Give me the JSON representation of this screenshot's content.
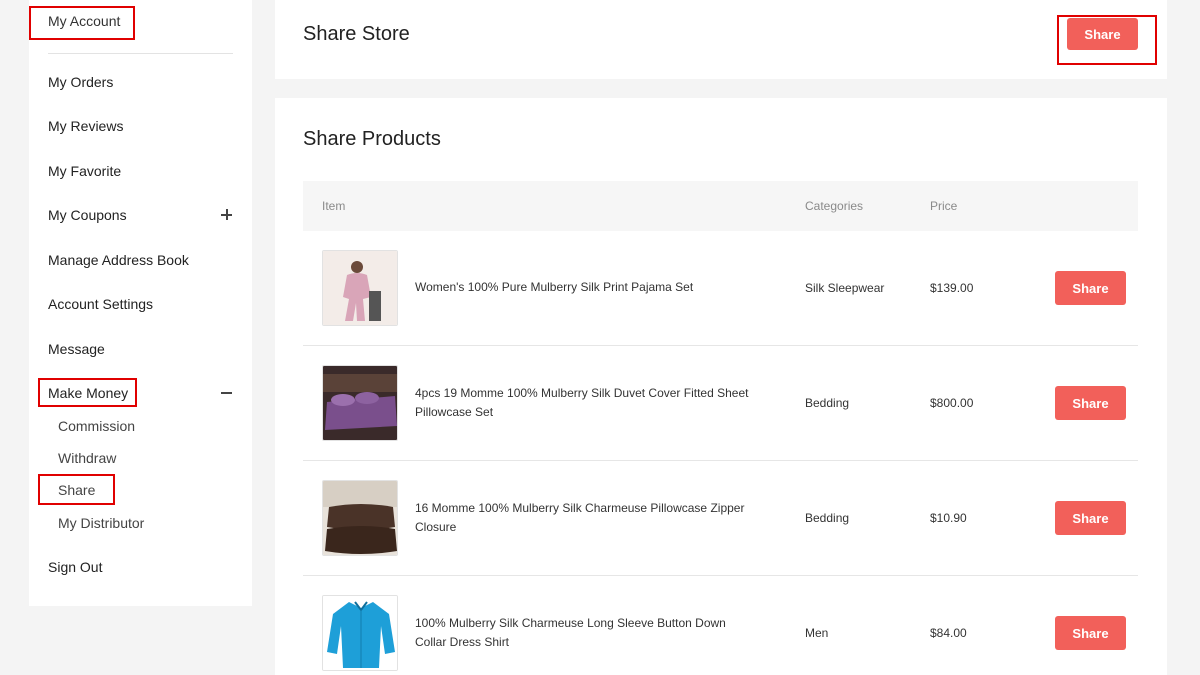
{
  "sidebar": {
    "account": "My Account",
    "items": [
      {
        "label": "My Orders"
      },
      {
        "label": "My Reviews"
      },
      {
        "label": "My Favorite"
      },
      {
        "label": "My Coupons",
        "toggle": "plus"
      },
      {
        "label": "Manage Address Book"
      },
      {
        "label": "Account Settings"
      },
      {
        "label": "Message"
      },
      {
        "label": "Make Money",
        "toggle": "minus"
      }
    ],
    "make_money_sub": [
      "Commission",
      "Withdraw",
      "Share",
      "My Distributor"
    ],
    "sign_out": "Sign Out"
  },
  "store": {
    "title": "Share Store",
    "share_label": "Share"
  },
  "products": {
    "title": "Share Products",
    "columns": [
      "Item",
      "Categories",
      "Price"
    ],
    "share_label": "Share",
    "rows": [
      {
        "name": "Women's 100% Pure Mulberry Silk Print Pajama Set",
        "category": "Silk Sleepwear",
        "price": "$139.00"
      },
      {
        "name": "4pcs 19 Momme 100% Mulberry Silk Duvet Cover Fitted Sheet Pillowcase Set",
        "category": "Bedding",
        "price": "$800.00"
      },
      {
        "name": "16 Momme 100% Mulberry Silk Charmeuse Pillowcase Zipper Closure",
        "category": "Bedding",
        "price": "$10.90"
      },
      {
        "name": "100% Mulberry Silk Charmeuse Long Sleeve Button Down Collar Dress Shirt",
        "category": "Men",
        "price": "$84.00"
      }
    ]
  },
  "colors": {
    "accent": "#f2605a",
    "highlight": "#e00000"
  }
}
